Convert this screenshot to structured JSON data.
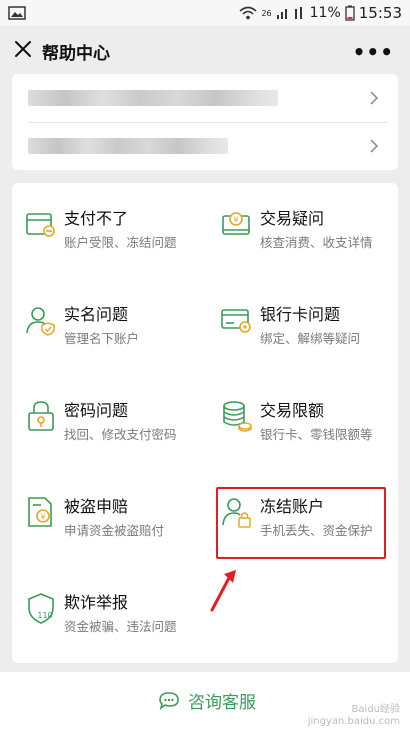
{
  "status_bar": {
    "battery": "11%",
    "time": "15:53",
    "signal_tag": "26"
  },
  "nav": {
    "title": "帮助中心",
    "more": "•••"
  },
  "items": [
    {
      "title": "支付不了",
      "sub": "账户受限、冻结问题",
      "icon": "card-lock-icon"
    },
    {
      "title": "交易疑问",
      "sub": "核查消费、收支详情",
      "icon": "payment-doubt-icon"
    },
    {
      "title": "实名问题",
      "sub": "管理名下账户",
      "icon": "user-shield-icon"
    },
    {
      "title": "银行卡问题",
      "sub": "绑定、解绑等疑问",
      "icon": "bank-card-gear-icon"
    },
    {
      "title": "密码问题",
      "sub": "找回、修改支付密码",
      "icon": "password-lock-icon"
    },
    {
      "title": "交易限额",
      "sub": "银行卡、零钱限额等",
      "icon": "coin-stack-icon"
    },
    {
      "title": "被盗申赔",
      "sub": "申请资金被盗赔付",
      "icon": "claim-document-icon"
    },
    {
      "title": "冻结账户",
      "sub": "手机丢失、资金保护",
      "icon": "user-lock-icon"
    },
    {
      "title": "欺诈举报",
      "sub": "资金被骗、违法问题",
      "icon": "report-110-icon"
    }
  ],
  "footer": {
    "consult_label": "咨询客服"
  },
  "watermark": {
    "line1": "Baidu经验",
    "line2": "jingyan.baidu.com"
  },
  "colors": {
    "accent": "#3a9b5a",
    "highlight": "#e02020"
  }
}
